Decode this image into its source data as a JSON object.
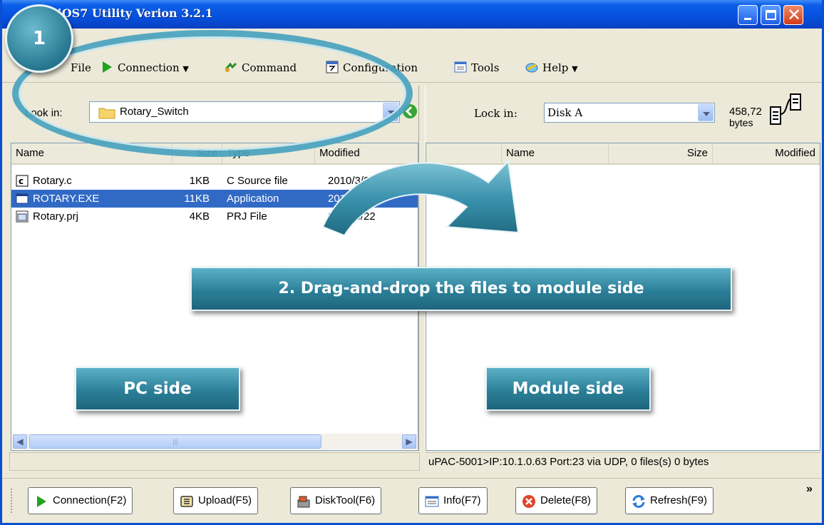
{
  "window": {
    "title": "MiniOS7 Utility Verion 3.2.1",
    "title_visible": "niOS7 Utility Verion 3.2.1"
  },
  "menu": {
    "file": "File",
    "connection": "Connection",
    "command": "Command",
    "configuration": "Configuration",
    "tools": "Tools",
    "help": "Help"
  },
  "left": {
    "lookin_label": "Look in:",
    "lookin_value": "Rotary_Switch",
    "columns": [
      "Name",
      "Size",
      "Type",
      "Modified"
    ],
    "files": [
      {
        "name": "Rotary.c",
        "size": "1KB",
        "type": "C Source file",
        "modified": "2010/3/22",
        "icon": "c-source-icon"
      },
      {
        "name": "ROTARY.EXE",
        "size": "11KB",
        "type": "Application",
        "modified": "2010/3/22",
        "icon": "exe-icon",
        "selected": true
      },
      {
        "name": "Rotary.prj",
        "size": "4KB",
        "type": "PRJ File",
        "modified": "2010/3/22",
        "icon": "prj-icon"
      }
    ]
  },
  "right": {
    "lookin_label": "Lock in:",
    "lookin_value": "Disk A",
    "free_space": "458,72",
    "free_unit": "bytes",
    "columns": [
      "Name",
      "Size",
      "Modified"
    ],
    "status": "uPAC-5001>IP:10.1.0.63 Port:23 via UDP, 0 files(s) 0 bytes"
  },
  "toolbar": {
    "connection": "Connection(F2)",
    "upload": "Upload(F5)",
    "disktool": "DiskTool(F6)",
    "info": "Info(F7)",
    "delete": "Delete(F8)",
    "refresh": "Refresh(F9)",
    "more": "»"
  },
  "annotations": {
    "step1": "1",
    "step2": "2. Drag-and-drop the files to module side",
    "pc_side": "PC side",
    "module_side": "Module side"
  },
  "colors": {
    "titlebar": "#0650de",
    "selection": "#316ac5",
    "callout": "#2b7f98"
  }
}
